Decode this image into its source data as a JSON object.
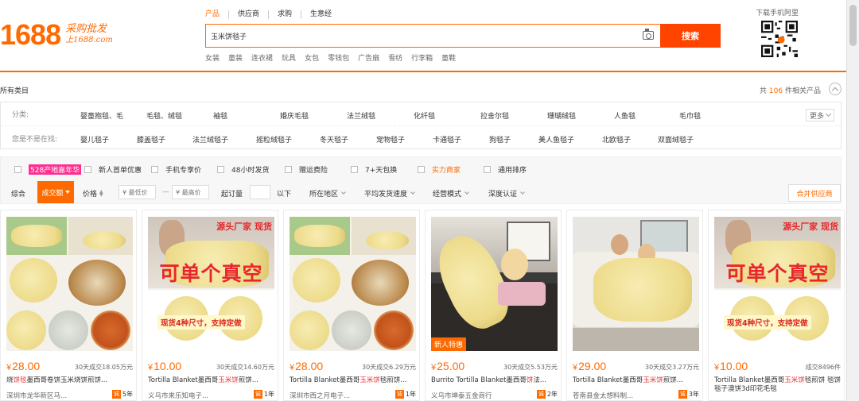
{
  "header": {
    "logo_number": "1688",
    "logo_line1": "采购批发",
    "logo_line2": "上1688.com",
    "search_tabs": [
      "产品",
      "供应商",
      "求购",
      "生意经"
    ],
    "search_value": "玉米饼毯子",
    "search_button": "搜索",
    "hot_words": [
      "女装",
      "童装",
      "连衣裙",
      "玩具",
      "女包",
      "零钱包",
      "广告扇",
      "雪纺",
      "行李箱",
      "童鞋"
    ],
    "qr_label": "下载手机阿里"
  },
  "category_bar": {
    "all_categories": "所有类目",
    "result_prefix": "共",
    "result_count": "106",
    "result_suffix": "件相关产品"
  },
  "filters": {
    "row1_label": "分类:",
    "row1_items": [
      "婴童抱毯、毛",
      "毛毯、绒毯",
      "袖毯",
      "婚庆毛毯",
      "法兰绒毯",
      "化纤毯",
      "拉舍尔毯",
      "珊瑚绒毯",
      "人鱼毯",
      "毛巾毯"
    ],
    "more": "更多",
    "row2_label": "您是不是在找:",
    "row2_items": [
      "婴儿毯子",
      "膝盖毯子",
      "法兰绒毯子",
      "摇粒绒毯子",
      "冬天毯子",
      "宠物毯子",
      "卡通毯子",
      "狗毯子",
      "美人鱼毯子",
      "北欧毯子",
      "双面绒毯子"
    ]
  },
  "services": {
    "badge": "528产地嘉年华",
    "items": [
      "新人首单优惠",
      "手机专享价",
      "48小时发货",
      "赠运费险",
      "7+天包换",
      "实力商家",
      "通用排序"
    ]
  },
  "sort_bar": {
    "overall": "综合",
    "active": "成交额",
    "price": "价格",
    "min_price_placeholder": "¥ 最低价",
    "max_price_placeholder": "¥ 最高价",
    "dash": "—",
    "min_order": "起订量",
    "below": "以下",
    "region": "所在地区",
    "shipping": "平均发货速度",
    "business_model": "经营模式",
    "certification": "深度认证",
    "merge_supplier": "合并供应商"
  },
  "products": [
    {
      "price": "28.00",
      "sold": "30天成交18.05万元",
      "title_pre": "烧",
      "title_hl": "饼毯",
      "title_post": "墨西哥卷饼玉米烧饼煎饼...",
      "shop": "深圳市龙华新区马...",
      "years": "5年",
      "new": ""
    },
    {
      "price": "10.00",
      "sold": "30天成交14.60万元",
      "title_pre": "Tortilla Blanket墨西哥",
      "title_hl": "玉米饼",
      "title_post": "煎饼...",
      "shop": "义乌市来乐知电子...",
      "years": "1年",
      "new": ""
    },
    {
      "price": "28.00",
      "sold": "30天成交6.29万元",
      "title_pre": "Tortilla Blanket墨西哥",
      "title_hl": "玉米饼",
      "title_post": "毯煎饼...",
      "shop": "深圳市西之月电子...",
      "years": "1年",
      "new": ""
    },
    {
      "price": "25.00",
      "sold": "30天成交5.53万元",
      "title_pre": "Burrito Tortilla Blanket墨西哥",
      "title_hl": "饼",
      "title_post": "法...",
      "shop": "义乌市坤泰五金商行",
      "years": "2年",
      "new": "新人特惠"
    },
    {
      "price": "29.00",
      "sold": "30天成交3.27万元",
      "title_pre": "Tortilla Blanket墨西哥",
      "title_hl": "玉米饼",
      "title_post": "煎饼...",
      "shop": "苍南县金太想料制...",
      "years": "3年",
      "new": ""
    },
    {
      "price": "10.00",
      "sold": "成交8496件",
      "title_pre": "Tortilla Blanket墨西哥",
      "title_hl": "玉米饼",
      "title_post": "毯煎饼 毯饼毯子澳饼3d印花毛毯",
      "shop": "",
      "years": "",
      "new": ""
    }
  ],
  "image_texts": {
    "big_red": "可单个真空",
    "top_tag": "源头厂家 现货",
    "yellow_tag": "现货4种尺寸，支持定做",
    "shop_badge": "诚"
  },
  "colors": {
    "accent": "#ff6a00",
    "search_button": "#ff4400",
    "highlight": "#e4393c",
    "badge_pink": "#ff2f92"
  }
}
